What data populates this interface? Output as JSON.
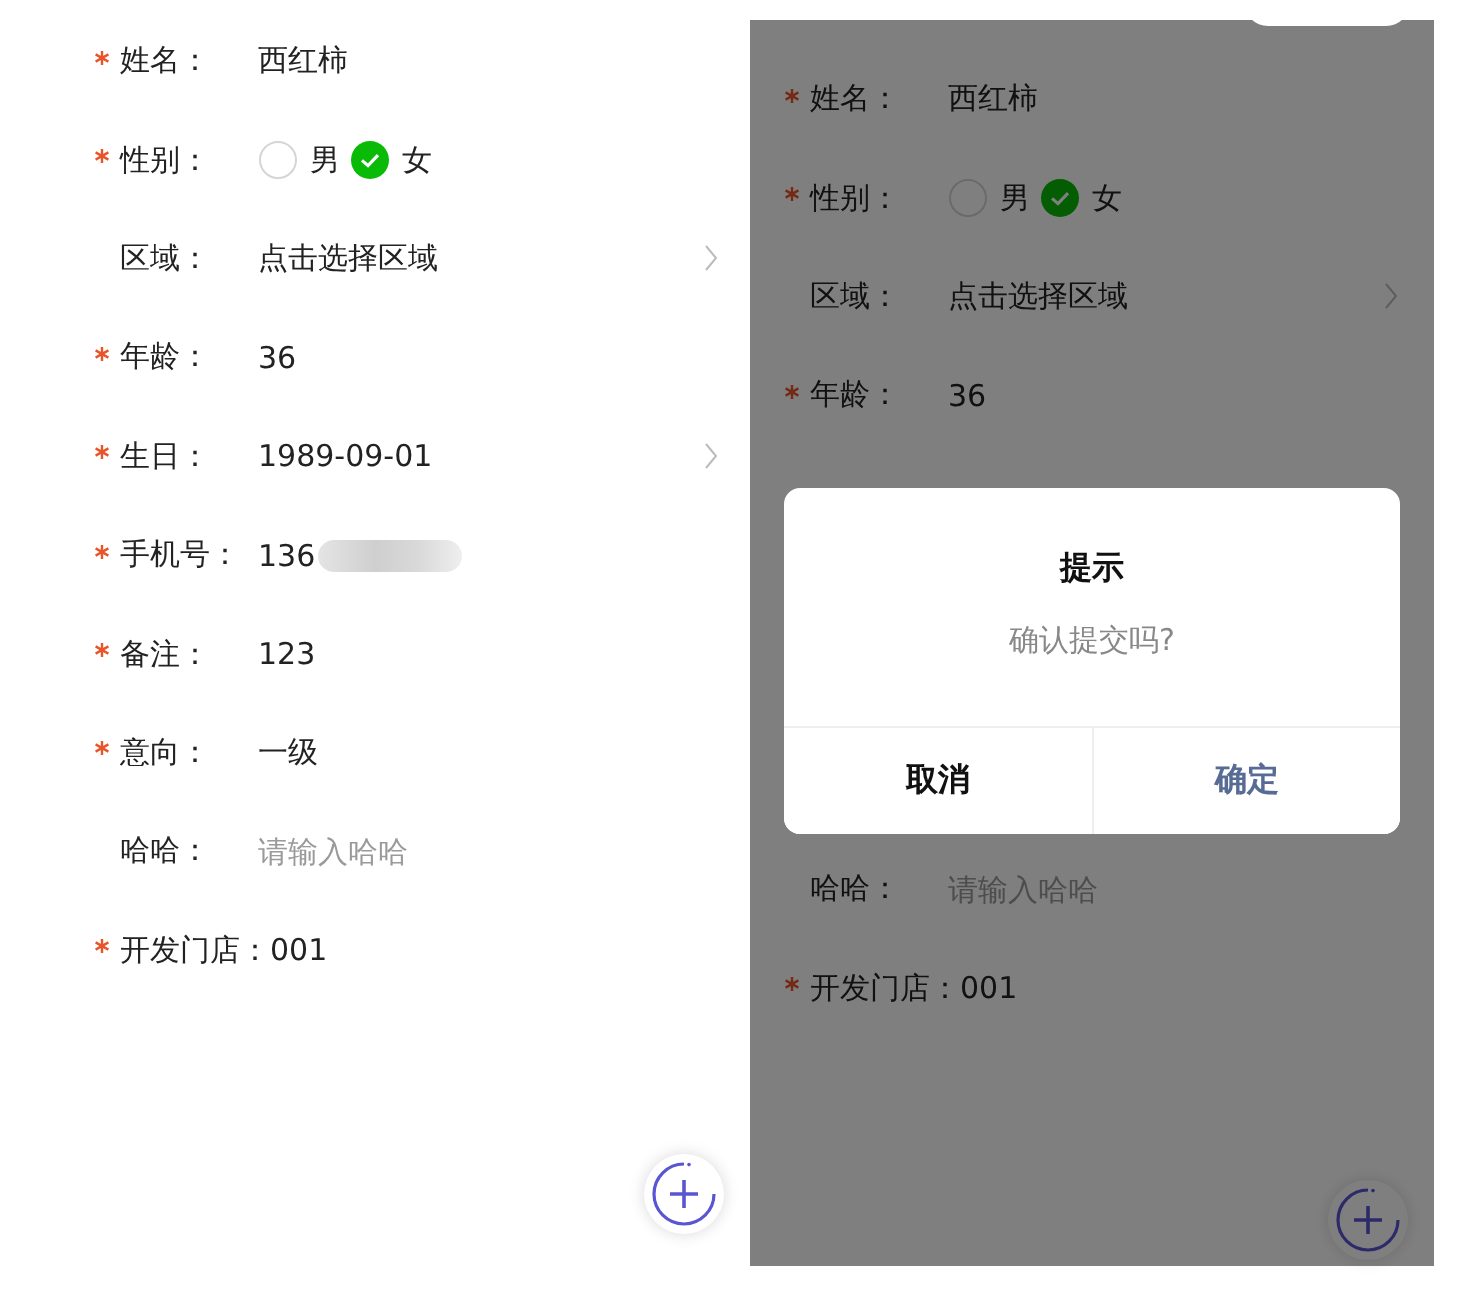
{
  "screens": [
    {
      "dimmed": false,
      "fields": [
        {
          "kind": "text",
          "required": true,
          "label": "姓名：",
          "value": "西红柿"
        },
        {
          "kind": "radio",
          "required": true,
          "label": "性别：",
          "options": [
            {
              "label": "男",
              "selected": false
            },
            {
              "label": "女",
              "selected": true
            }
          ]
        },
        {
          "kind": "select",
          "required": false,
          "label": "区域：",
          "value": "点击选择区域"
        },
        {
          "kind": "text",
          "required": true,
          "label": "年龄：",
          "value": "36"
        },
        {
          "kind": "select",
          "required": true,
          "label": "生日：",
          "value": "1989-09-01"
        },
        {
          "kind": "redacted",
          "required": true,
          "label": "手机号：",
          "value": "136"
        },
        {
          "kind": "text",
          "required": true,
          "label": "备注：",
          "value": "123"
        },
        {
          "kind": "text",
          "required": true,
          "label": "意向：",
          "value": "一级"
        },
        {
          "kind": "input",
          "required": false,
          "label": "哈哈：",
          "placeholder": "请输入哈哈"
        },
        {
          "kind": "text",
          "required": true,
          "label": "开发门店：",
          "value": "001"
        }
      ]
    },
    {
      "dimmed": true,
      "fields": [
        {
          "kind": "text",
          "required": true,
          "label": "姓名：",
          "value": "西红柿"
        },
        {
          "kind": "radio",
          "required": true,
          "label": "性别：",
          "options": [
            {
              "label": "男",
              "selected": false
            },
            {
              "label": "女",
              "selected": true
            }
          ]
        },
        {
          "kind": "select",
          "required": false,
          "label": "区域：",
          "value": "点击选择区域"
        },
        {
          "kind": "text",
          "required": true,
          "label": "年龄：",
          "value": "36"
        },
        {
          "kind": "gap"
        },
        {
          "kind": "gap"
        },
        {
          "kind": "gap"
        },
        {
          "kind": "gap"
        },
        {
          "kind": "input",
          "required": false,
          "label": "哈哈：",
          "placeholder": "请输入哈哈"
        },
        {
          "kind": "text",
          "required": true,
          "label": "开发门店：",
          "value": "001"
        }
      ],
      "dialog": {
        "title": "提示",
        "message": "确认提交吗?",
        "buttons": [
          {
            "label": "取消",
            "kind": "cancel"
          },
          {
            "label": "确定",
            "kind": "confirm"
          }
        ]
      }
    }
  ]
}
